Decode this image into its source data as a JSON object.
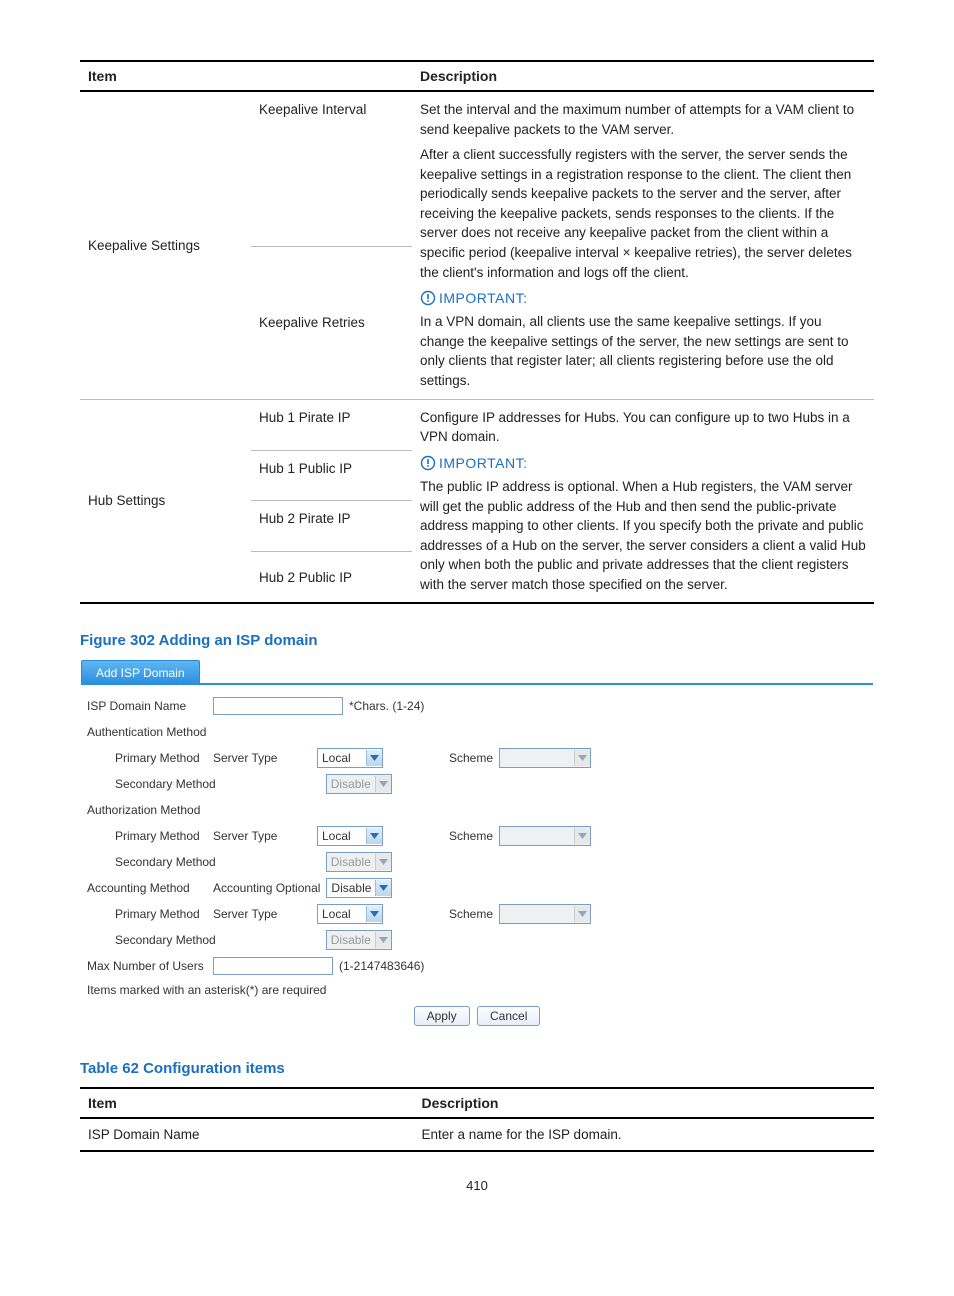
{
  "table1": {
    "headers": {
      "item": "Item",
      "desc": "Description"
    },
    "keepalive": {
      "group": "Keepalive Settings",
      "interval_item": "Keepalive Interval",
      "interval_desc": "Set the interval and the maximum number of attempts for a VAM client to send keepalive packets to the VAM server.",
      "retries_item": "Keepalive Retries",
      "retries_desc_p1": "After a client successfully registers with the server, the server sends the keepalive settings in a registration response to the client. The client then periodically sends keepalive packets to the server and the server, after receiving the keepalive packets, sends responses to the clients. If the server does not receive any keepalive packet from the client within a specific period (keepalive interval × keepalive retries), the server deletes the client's information and logs off the client.",
      "important_label": "IMPORTANT:",
      "retries_desc_p2": "In a VPN domain, all clients use the same keepalive settings. If you change the keepalive settings of the server, the new settings are sent to only clients that register later; all clients registering before use the old settings."
    },
    "hub": {
      "group": "Hub Settings",
      "items": [
        "Hub 1 Pirate IP",
        "Hub 1 Public IP",
        "Hub 2 Pirate IP",
        "Hub 2 Public IP"
      ],
      "desc_p1": "Configure IP addresses for Hubs. You can configure up to two Hubs in a VPN domain.",
      "important_label": "IMPORTANT:",
      "desc_p2": "The public IP address is optional. When a Hub registers, the VAM server will get the public address of the Hub and then send the public-private address mapping to other clients. If you specify both the private and public addresses of a Hub on the server, the server considers a client a valid Hub only when both the public and private addresses that the client registers with the server match those specified on the server."
    }
  },
  "figure_caption": "Figure 302 Adding an ISP domain",
  "form": {
    "tab": "Add ISP Domain",
    "isp_name_label": "ISP Domain Name",
    "isp_name_hint": "*Chars. (1-24)",
    "authn_label": "Authentication Method",
    "primary_label": "Primary Method",
    "secondary_label": "Secondary Method",
    "server_type_label": "Server Type",
    "scheme_label": "Scheme",
    "local_opt": "Local",
    "disable_opt": "Disable",
    "authz_label": "Authorization Method",
    "acct_label": "Accounting Method",
    "acct_optional_label": "Accounting Optional",
    "max_users_label": "Max Number of Users",
    "max_users_hint": "(1-2147483646)",
    "req_note": "Items marked with an asterisk(*) are required",
    "apply": "Apply",
    "cancel": "Cancel"
  },
  "table2_caption": "Table 62 Configuration items",
  "table2": {
    "headers": {
      "item": "Item",
      "desc": "Description"
    },
    "row1_item": "ISP Domain Name",
    "row1_desc": "Enter a name for the ISP domain."
  },
  "page_number": "410"
}
